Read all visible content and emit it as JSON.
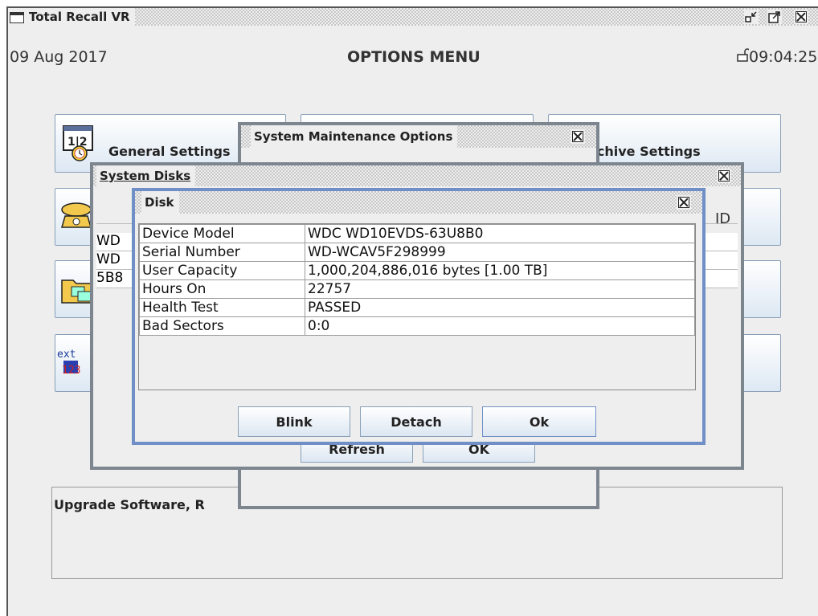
{
  "window": {
    "title": "Total Recall VR",
    "date": "09 Aug 2017",
    "heading": "OPTIONS MENU",
    "time": "09:04:25"
  },
  "tiles": {
    "general": "General Settings",
    "archive": "rchive Settings",
    "upgrade": "Upgrade Software, R"
  },
  "maintenance_dialog": {
    "title": "System Maintenance Options"
  },
  "disks_dialog": {
    "title": "System Disks",
    "col_fragment": "ID",
    "row_fragments": [
      "WD",
      "WD",
      "5B8"
    ],
    "hidden_buttons": [
      "Refresh",
      "OK"
    ]
  },
  "disk_dialog": {
    "title": "Disk",
    "rows": [
      {
        "label": "Device Model",
        "value": "WDC WD10EVDS-63U8B0"
      },
      {
        "label": "Serial Number",
        "value": "WD-WCAV5F298999"
      },
      {
        "label": "User Capacity",
        "value": "1,000,204,886,016 bytes [1.00 TB]"
      },
      {
        "label": "Hours On",
        "value": "22757"
      },
      {
        "label": "Health Test",
        "value": "PASSED"
      },
      {
        "label": "Bad Sectors",
        "value": "0:0"
      }
    ],
    "buttons": {
      "blink": "Blink",
      "detach": "Detach",
      "ok": "Ok"
    }
  },
  "icons": {
    "calendar_text": "1|2",
    "ext_text": "ext",
    "num_text": "123"
  }
}
